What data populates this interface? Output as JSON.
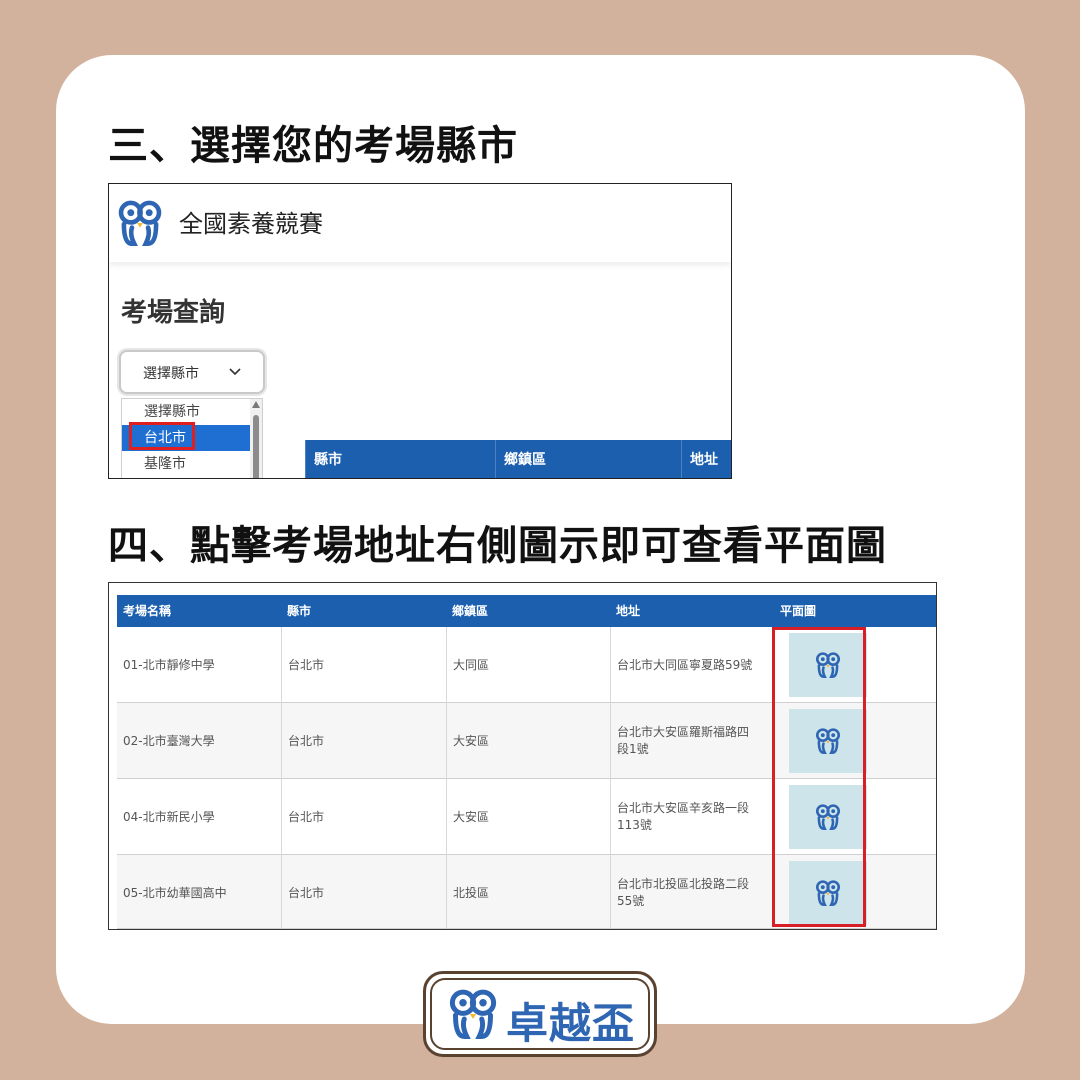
{
  "headings": {
    "step3": "三、選擇您的考場縣市",
    "step4": "四、點擊考場地址右側圖示即可查看平面圖"
  },
  "screenshot1": {
    "app_title": "全國素養競賽",
    "page_title": "考場查詢",
    "select": {
      "selected_value": "選擇縣市"
    },
    "dropdown_options": [
      "選擇縣市",
      "台北市",
      "基隆市"
    ],
    "highlighted_option": "台北市",
    "table_headers": [
      "縣市",
      "鄉鎮區",
      "地址"
    ]
  },
  "screenshot2": {
    "table_headers": [
      "考場名稱",
      "縣市",
      "鄉鎮區",
      "地址",
      "平面圖"
    ],
    "rows": [
      {
        "name": "01-北市靜修中學",
        "city": "台北市",
        "district": "大同區",
        "address": "台北市大同區寧夏路59號"
      },
      {
        "name": "02-北市臺灣大學",
        "city": "台北市",
        "district": "大安區",
        "address": "台北市大安區羅斯福路四段1號"
      },
      {
        "name": "04-北市新民小學",
        "city": "台北市",
        "district": "大安區",
        "address": "台北市大安區辛亥路一段113號"
      },
      {
        "name": "05-北市幼華國高中",
        "city": "台北市",
        "district": "北投區",
        "address": "台北市北投區北投路二段55號"
      }
    ],
    "map_icon": "owl-logo-icon"
  },
  "brand": {
    "name": "卓越盃"
  },
  "colors": {
    "background": "#d2b29d",
    "table_header": "#1b5fae",
    "highlight_red": "#d81e26",
    "brand_blue": "#2f66b3",
    "map_button": "#cde4ea"
  }
}
